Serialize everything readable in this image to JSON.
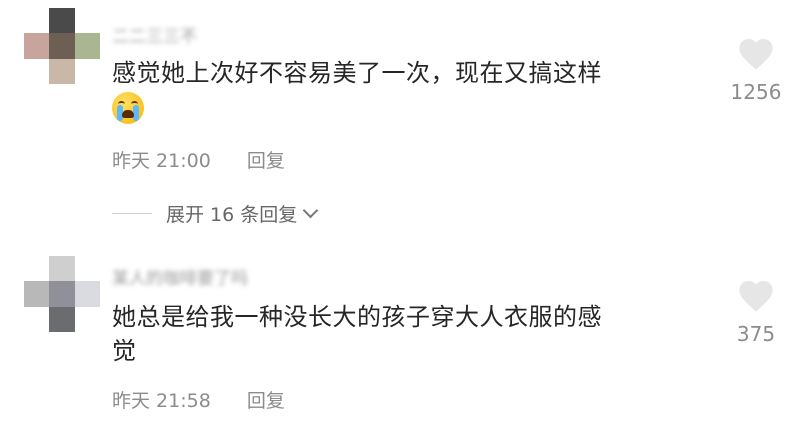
{
  "comments": [
    {
      "username": "二二三三不",
      "text": "感觉她上次好不容易美了一次，现在又搞这样",
      "emoji": "loudly-crying-face",
      "time": "昨天 21:00",
      "reply_label": "回复",
      "expand_label": "展开 16 条回复",
      "likes": "1256"
    },
    {
      "username": "某人的咖啡要了吗",
      "text_line1": "她总是给我一种没长大的孩子穿大人衣服的感",
      "text_line2": "觉",
      "time": "昨天 21:58",
      "reply_label": "回复",
      "likes": "375"
    }
  ],
  "icons": {
    "like": "heart-icon",
    "expand": "chevron-down-icon"
  },
  "colors": {
    "text": "#262626",
    "meta": "#8c8c8c",
    "heart": "#e6e6e6"
  }
}
